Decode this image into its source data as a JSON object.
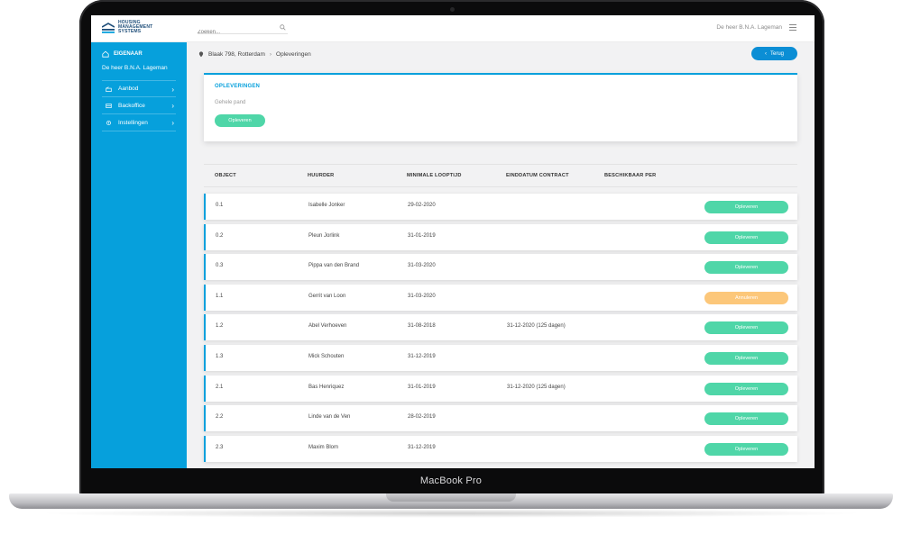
{
  "device_label": "MacBook Pro",
  "topbar": {
    "logo_lines": [
      "HOUSING",
      "MANAGEMENT",
      "SYSTEMS"
    ],
    "search_placeholder": "Zoeken...",
    "user": "De heer B.N.A. Lageman"
  },
  "sidebar": {
    "role": "EIGENAAR",
    "owner": "De heer B.N.A. Lageman",
    "items": [
      {
        "label": "Aanbod",
        "icon": "tag-icon"
      },
      {
        "label": "Backoffice",
        "icon": "inbox-icon"
      },
      {
        "label": "Instellingen",
        "icon": "gear-icon"
      }
    ]
  },
  "breadcrumb": {
    "address": "Blaak 798, Rotterdam",
    "page": "Opleveringen"
  },
  "back_button": "Terug",
  "card": {
    "title": "OPLEVERINGEN",
    "subtitle": "Gehele pand",
    "button": "Opleveren"
  },
  "table": {
    "headers": [
      "OBJECT",
      "HUURDER",
      "MINIMALE LOOPTIJD",
      "EINDDATUM CONTRACT",
      "BESCHIKBAAR PER"
    ],
    "rows": [
      {
        "object": "0.1",
        "tenant": "Isabelle Jonker",
        "min": "29-02-2020",
        "end": "",
        "avail": "",
        "action": "Opleveren",
        "status": "green"
      },
      {
        "object": "0.2",
        "tenant": "Pleun Jorlink",
        "min": "31-01-2019",
        "end": "",
        "avail": "",
        "action": "Opleveren",
        "status": "green"
      },
      {
        "object": "0.3",
        "tenant": "Pippa van den Brand",
        "min": "31-03-2020",
        "end": "",
        "avail": "",
        "action": "Opleveren",
        "status": "green"
      },
      {
        "object": "1.1",
        "tenant": "Gerrit van Loon",
        "min": "31-03-2020",
        "end": "",
        "avail": "",
        "action": "Annuleren",
        "status": "orange"
      },
      {
        "object": "1.2",
        "tenant": "Abel Verhoeven",
        "min": "31-08-2018",
        "end": "31-12-2020 (125 dagen)",
        "avail": "",
        "action": "Opleveren",
        "status": "green"
      },
      {
        "object": "1.3",
        "tenant": "Mick Schouten",
        "min": "31-12-2019",
        "end": "",
        "avail": "",
        "action": "Opleveren",
        "status": "green"
      },
      {
        "object": "2.1",
        "tenant": "Bas Henriquez",
        "min": "31-01-2019",
        "end": "31-12-2020 (125 dagen)",
        "avail": "",
        "action": "Opleveren",
        "status": "green"
      },
      {
        "object": "2.2",
        "tenant": "Linde van de Ven",
        "min": "28-02-2019",
        "end": "",
        "avail": "",
        "action": "Opleveren",
        "status": "green"
      },
      {
        "object": "2.3",
        "tenant": "Maxim Blom",
        "min": "31-12-2019",
        "end": "",
        "avail": "",
        "action": "Opleveren",
        "status": "green"
      }
    ]
  },
  "colors": {
    "primary": "#06a0dc",
    "button_blue": "#0b8ed5",
    "green": "#4fd6a8",
    "orange": "#fcc77a"
  }
}
